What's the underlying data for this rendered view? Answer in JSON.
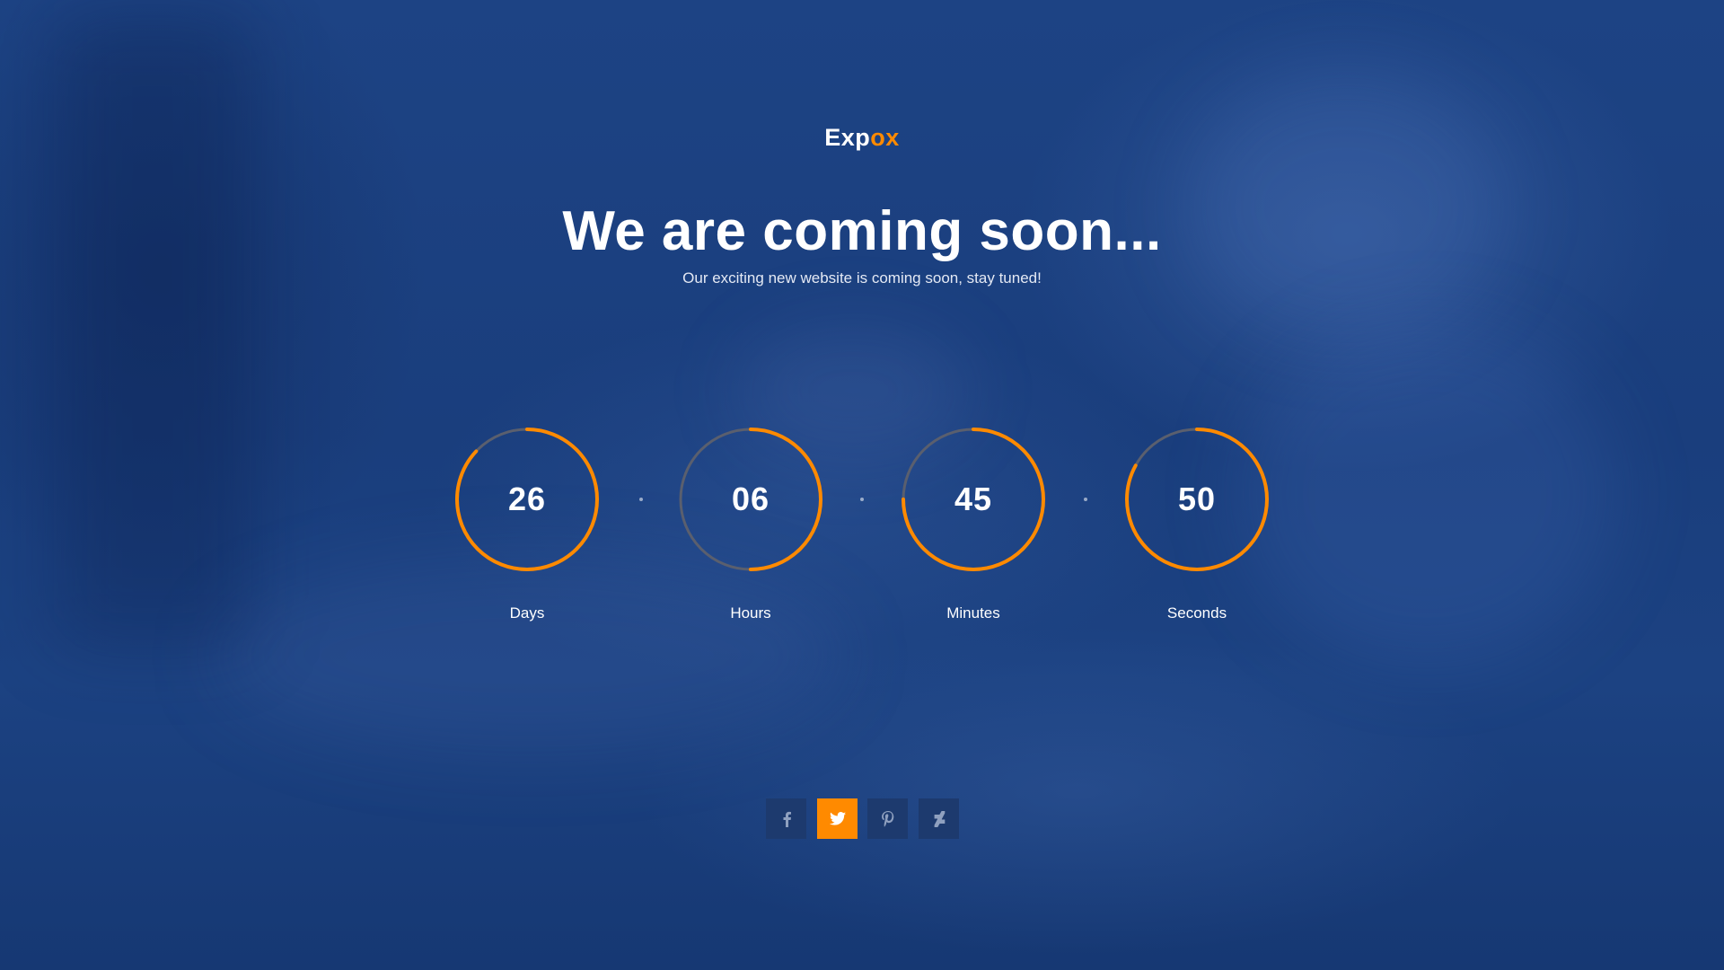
{
  "brand": {
    "logo_prefix": "Exp",
    "logo_suffix": "ox",
    "accent_color": "#ff8a00"
  },
  "hero": {
    "title": "We are coming soon...",
    "subtitle": "Our exciting new website is coming soon, stay tuned!"
  },
  "countdown": [
    {
      "value": "26",
      "label": "Days",
      "progress": 0.87
    },
    {
      "value": "06",
      "label": "Hours",
      "progress": 0.5
    },
    {
      "value": "45",
      "label": "Minutes",
      "progress": 0.75
    },
    {
      "value": "50",
      "label": "Seconds",
      "progress": 0.83
    }
  ],
  "colors": {
    "background": "#1b3f7e",
    "ring_track": "#5a5f6e",
    "ring_fill": "#ff8a00",
    "social_tile": "#1d3a6e",
    "social_tile_active": "#ff8a00"
  },
  "social": [
    {
      "icon": "facebook-icon",
      "active": false
    },
    {
      "icon": "twitter-icon",
      "active": true
    },
    {
      "icon": "pinterest-icon",
      "active": false
    },
    {
      "icon": "deviantart-icon",
      "active": false
    }
  ]
}
